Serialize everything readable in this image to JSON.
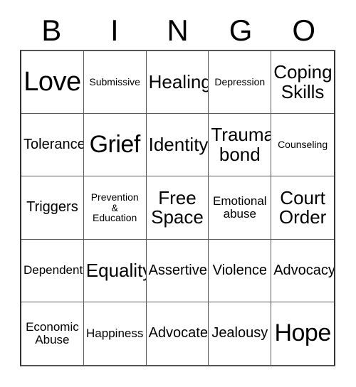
{
  "card": {
    "title": "BINGO",
    "header_letters": [
      "B",
      "I",
      "N",
      "G",
      "O"
    ],
    "columns": 5,
    "rows": 5,
    "free_space_label": "Free\nSpace",
    "colors": {
      "background": "#ffffff",
      "text": "#000000",
      "grid_line": "#595959",
      "grid_outer_border": "#333333"
    },
    "cells": [
      {
        "text": "Love",
        "size": "xl"
      },
      {
        "text": "Submissive",
        "size": "xxs"
      },
      {
        "text": "Healing",
        "size": "md"
      },
      {
        "text": "Depression",
        "size": "xxs"
      },
      {
        "text": "Coping\nSkills",
        "size": "md"
      },
      {
        "text": "Tolerance",
        "size": "sm"
      },
      {
        "text": "Grief",
        "size": "lg"
      },
      {
        "text": "Identity",
        "size": "md"
      },
      {
        "text": "Trauma\nbond",
        "size": "md"
      },
      {
        "text": "Counseling",
        "size": "xxs"
      },
      {
        "text": "Triggers",
        "size": "sm"
      },
      {
        "text": "Prevention\n&\nEducation",
        "size": "xxs"
      },
      {
        "text": "Free\nSpace",
        "size": "md"
      },
      {
        "text": "Emotional\nabuse",
        "size": "xs"
      },
      {
        "text": "Court\nOrder",
        "size": "md"
      },
      {
        "text": "Dependent",
        "size": "xs"
      },
      {
        "text": "Equality",
        "size": "md"
      },
      {
        "text": "Assertive",
        "size": "sm"
      },
      {
        "text": "Violence",
        "size": "sm"
      },
      {
        "text": "Advocacy",
        "size": "sm"
      },
      {
        "text": "Economic\nAbuse",
        "size": "xs"
      },
      {
        "text": "Happiness",
        "size": "xs"
      },
      {
        "text": "Advocate",
        "size": "sm"
      },
      {
        "text": "Jealousy",
        "size": "sm"
      },
      {
        "text": "Hope",
        "size": "lg"
      }
    ]
  }
}
